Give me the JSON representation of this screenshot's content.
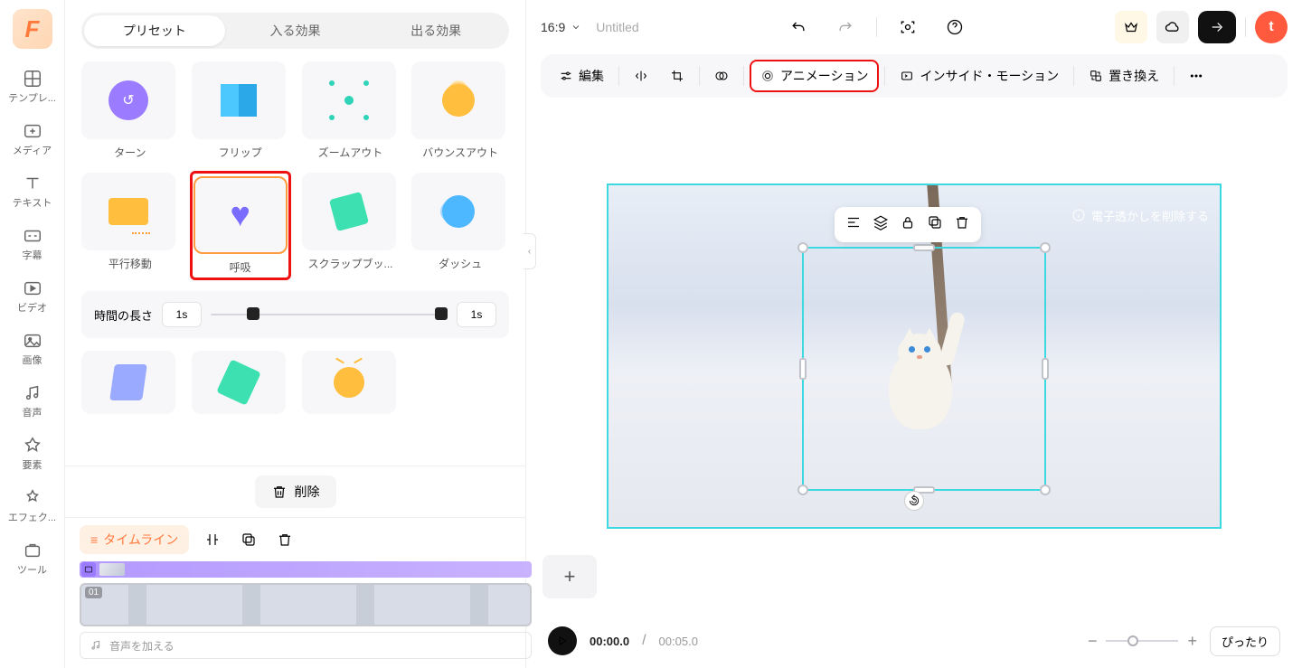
{
  "sidebar": {
    "items": [
      {
        "label": "テンプレ..."
      },
      {
        "label": "メディア"
      },
      {
        "label": "テキスト"
      },
      {
        "label": "字幕"
      },
      {
        "label": "ビデオ"
      },
      {
        "label": "画像"
      },
      {
        "label": "音声"
      },
      {
        "label": "要素"
      },
      {
        "label": "エフェク..."
      },
      {
        "label": "ツール"
      }
    ]
  },
  "tabs": {
    "preset": "プリセット",
    "enter": "入る効果",
    "exit": "出る効果"
  },
  "presets": {
    "row1": [
      {
        "label": "ターン"
      },
      {
        "label": "フリップ"
      },
      {
        "label": "ズームアウト"
      },
      {
        "label": "バウンスアウト"
      }
    ],
    "row2": [
      {
        "label": "平行移動"
      },
      {
        "label": "呼吸"
      },
      {
        "label": "スクラップブッ..."
      },
      {
        "label": "ダッシュ"
      }
    ]
  },
  "duration": {
    "label": "時間の長さ",
    "start": "1s",
    "end": "1s"
  },
  "delete_label": "削除",
  "timeline_label": "タイムライン",
  "clip_num": "01",
  "audio_placeholder": "音声を加える",
  "titlebar": {
    "aspect": "16:9",
    "title": "Untitled",
    "avatar": "t"
  },
  "toolbar": {
    "edit": "編集",
    "animation": "アニメーション",
    "inside_motion": "インサイド・モーション",
    "replace": "置き換え"
  },
  "canvas": {
    "watermark_remove": "電子透かしを削除する"
  },
  "player": {
    "current": "00:00.0",
    "total": "00:05.0",
    "fit": "ぴったり"
  }
}
